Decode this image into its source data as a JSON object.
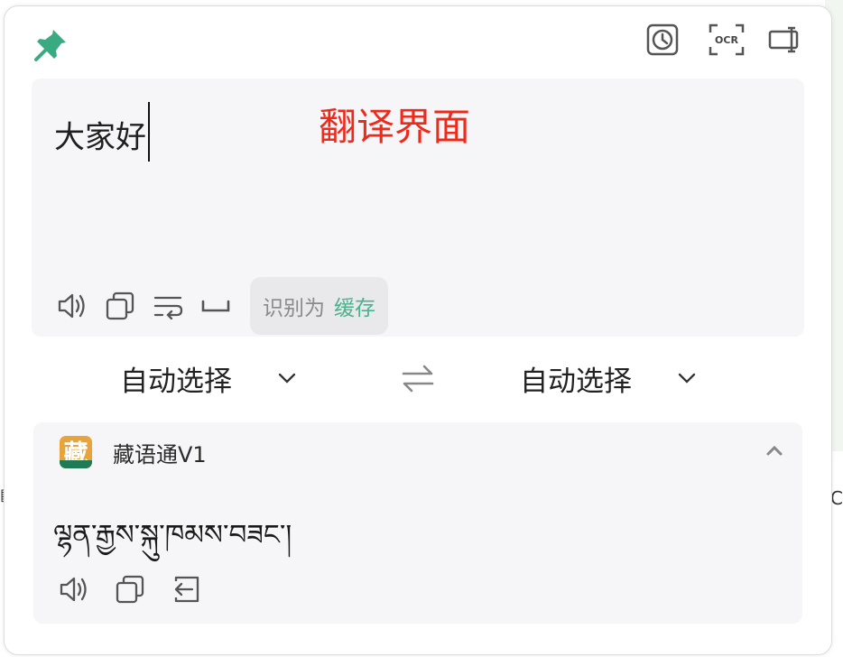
{
  "colors": {
    "accent": "#4bb28d",
    "annotation": "#ee2a1b",
    "panel_bg": "#f6f5f7",
    "pin": "#3aaa82"
  },
  "toolbar": {
    "pin_icon": "pin-icon",
    "history_icon": "history-clock-icon",
    "ocr_label": "OCR",
    "side_panel_icon": "side-panel-icon"
  },
  "input": {
    "text": "大家好",
    "annotation": "翻译界面",
    "detected_prefix": "识别为",
    "detected_language": "缓存",
    "tool_icons": [
      "speaker-icon",
      "copy-icon",
      "wrap-text-icon",
      "space-icon"
    ]
  },
  "languages": {
    "source": "自动选择",
    "target": "自动选择",
    "swap_icon": "swap-icon"
  },
  "result": {
    "service_logo_char": "藏",
    "service_name": "藏语通V1",
    "text": "ལྷན་རྒྱས་སྐུ་ཁམས་བཟང་།",
    "tool_icons": [
      "speaker-icon",
      "copy-icon",
      "insert-icon"
    ]
  },
  "edge_glyphs": {
    "left": "▤",
    "right": "C"
  }
}
